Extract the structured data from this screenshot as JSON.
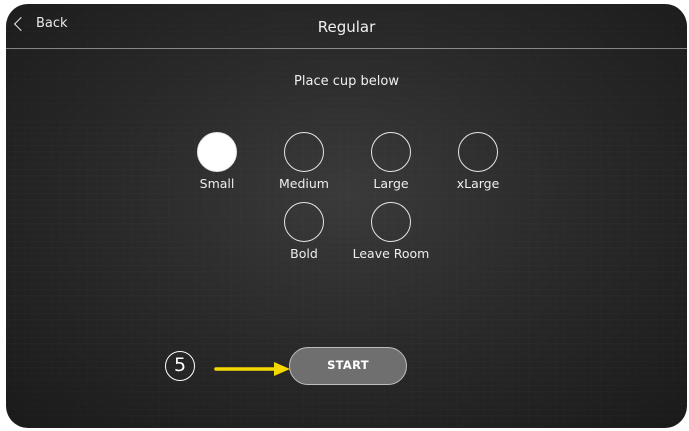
{
  "header": {
    "back_label": "Back",
    "title": "Regular"
  },
  "instruction": "Place cup below",
  "sizes": [
    {
      "label": "Small",
      "selected": true
    },
    {
      "label": "Medium",
      "selected": false
    },
    {
      "label": "Large",
      "selected": false
    },
    {
      "label": "xLarge",
      "selected": false
    },
    {
      "label": "Bold",
      "selected": false
    },
    {
      "label": "Leave Room",
      "selected": false
    }
  ],
  "start_label": "START",
  "annotation": {
    "step_number": "5",
    "arrow_color": "#f5d800"
  }
}
